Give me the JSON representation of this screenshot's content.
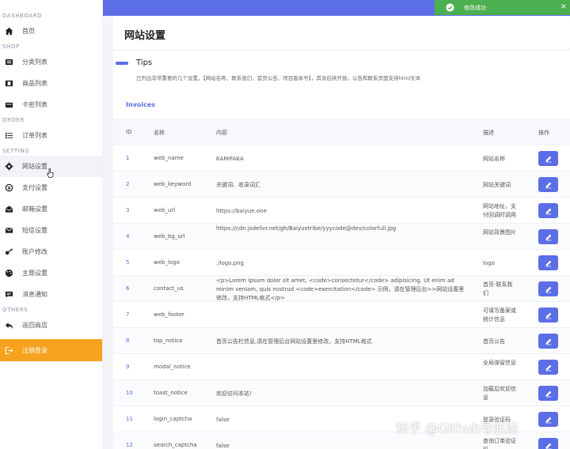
{
  "sidebar": {
    "sections": [
      {
        "title": "DASHBOARD",
        "items": [
          {
            "label": "首页",
            "icon": "home-icon"
          }
        ]
      },
      {
        "title": "SHOP",
        "items": [
          {
            "label": "分类列表",
            "icon": "list-icon"
          },
          {
            "label": "商品列表",
            "icon": "film-icon"
          },
          {
            "label": "卡密列表",
            "icon": "card-icon"
          }
        ]
      },
      {
        "title": "ORDER",
        "items": [
          {
            "label": "订单列表",
            "icon": "list-bullet-icon"
          }
        ]
      },
      {
        "title": "SETTING",
        "items": [
          {
            "label": "网站设置",
            "icon": "gear-icon"
          },
          {
            "label": "支付设置",
            "icon": "payment-icon"
          },
          {
            "label": "邮箱设置",
            "icon": "mail-open-icon"
          },
          {
            "label": "短信设置",
            "icon": "envelope-icon"
          },
          {
            "label": "账户修改",
            "icon": "key-icon"
          },
          {
            "label": "主题设置",
            "icon": "palette-icon"
          },
          {
            "label": "消息通知",
            "icon": "message-icon"
          }
        ]
      },
      {
        "title": "OTHERS",
        "items": [
          {
            "label": "返回商店",
            "icon": "reply-icon"
          },
          {
            "label": "注销登录",
            "icon": "logout-icon"
          }
        ]
      }
    ]
  },
  "header": {
    "title": "网站设置"
  },
  "tips": {
    "title": "Tips",
    "text": "已列出非常重要的几个设置，【网站名称、联系我们、首页公告、项目版本号】，其余后续开放。公告和联系页面支持html文本"
  },
  "table": {
    "title": "Invoices",
    "columns": [
      "ID",
      "名称",
      "内容",
      "描述",
      "操作"
    ],
    "rows": [
      {
        "id": "1",
        "name": "web_name",
        "value": "KAMIFAKA",
        "desc": "网站名称"
      },
      {
        "id": "2",
        "name": "web_keyword",
        "value": "关键词、收录词汇",
        "desc": "网站关键词"
      },
      {
        "id": "3",
        "name": "web_url",
        "value": "https://baiyue.one",
        "desc": "网站地址，支付回调时调用"
      },
      {
        "id": "4",
        "name": "web_bg_url",
        "value": "https://cdn.jsdelivr.net/gh/Baiyuetribe/yyycode@dev/colorfull.jpg",
        "desc": "网站背景图片"
      },
      {
        "id": "5",
        "name": "web_logo",
        "value": "./logo.png",
        "desc": "logo"
      },
      {
        "id": "6",
        "name": "contact_us",
        "value": "<p>Lorem ipsum dolor sit amet, <code>consectetur</code> adipisicing. Ut enim ad minim veniam, quis nostrud <code>exercitation</code> 示例，请在管理后台>>网站设置里修改，支持HTML格式</p>",
        "desc": "首页-联系我们"
      },
      {
        "id": "7",
        "name": "web_footer",
        "value": "",
        "desc": "可填写备案或统计信息"
      },
      {
        "id": "8",
        "name": "top_notice",
        "value": "首页公告栏信息,请在管理后台网站设置里修改，支持HTML格式",
        "desc": "首页公告"
      },
      {
        "id": "9",
        "name": "modal_notice",
        "value": "",
        "desc": "全局弹窗信息"
      },
      {
        "id": "10",
        "name": "toast_notice",
        "value": "欢迎访问本站！",
        "desc": "加载后欢迎信息"
      },
      {
        "id": "11",
        "name": "login_captcha",
        "value": "false",
        "desc": "登录验证码"
      },
      {
        "id": "12",
        "name": "search_captcha",
        "value": "false",
        "desc": "查询订单验证码"
      }
    ]
  },
  "toast": {
    "message": "修改成功",
    "close": "×"
  },
  "watermark": "知乎 @Github导航站",
  "colors": {
    "accent": "#5c6ee6",
    "toast": "#4caf50",
    "logout": "#f6a21e"
  }
}
